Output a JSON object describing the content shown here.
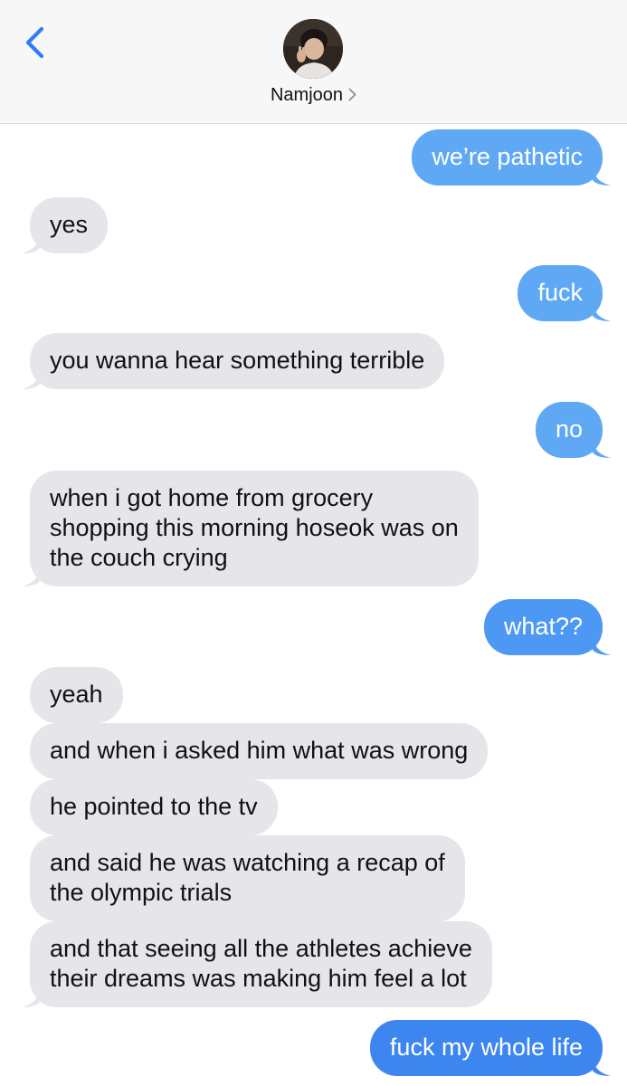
{
  "header": {
    "contact_name": "Namjoon",
    "icons": {
      "back": "chevron-left-icon",
      "details": "chevron-right-icon"
    },
    "accent_color": "#2f7df6"
  },
  "colors": {
    "received_bubble": "#e5e5ea",
    "sent_bubble_top": "#5fa8f4",
    "sent_bubble_bottom": "#3d86ef"
  },
  "messages": [
    {
      "direction": "sent",
      "text": "we’re pathetic"
    },
    {
      "direction": "received",
      "text": "yes"
    },
    {
      "direction": "sent",
      "text": "fuck"
    },
    {
      "direction": "received",
      "text": "you wanna hear something terrible"
    },
    {
      "direction": "sent",
      "text": "no"
    },
    {
      "direction": "received",
      "lines": [
        "when i got home from grocery",
        "shopping this morning hoseok was on",
        "the couch crying"
      ]
    },
    {
      "direction": "sent",
      "text": "what??"
    },
    {
      "direction": "received",
      "text": "yeah"
    },
    {
      "direction": "received",
      "text": "and when i asked him what was wrong"
    },
    {
      "direction": "received",
      "text": "he pointed to the tv"
    },
    {
      "direction": "received",
      "lines": [
        "and said he was watching a recap of",
        "the olympic trials"
      ]
    },
    {
      "direction": "received",
      "lines": [
        "and that seeing all the athletes achieve",
        "their dreams was making him feel a lot"
      ]
    },
    {
      "direction": "sent",
      "text": "fuck my whole life"
    }
  ]
}
